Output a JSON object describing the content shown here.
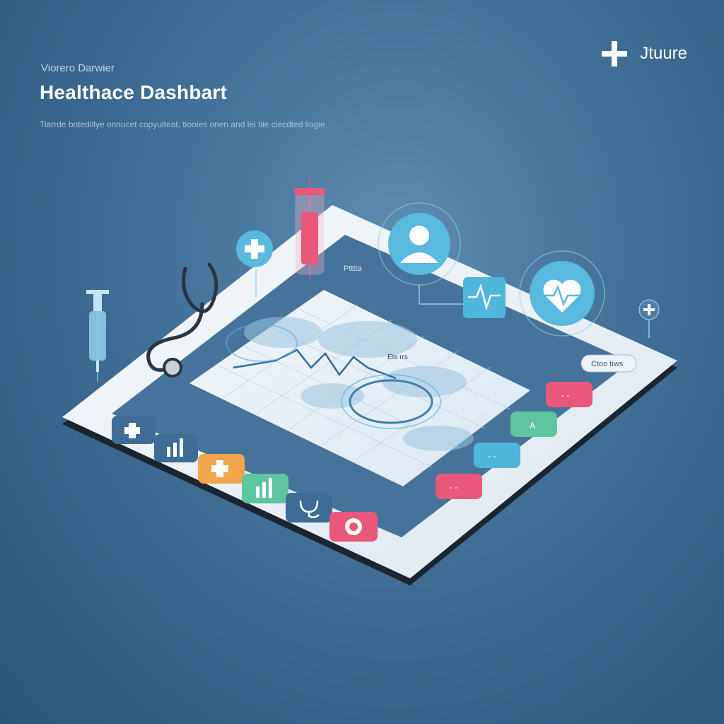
{
  "header": {
    "eyebrow": "Viorero Darwier",
    "title": "Healthace Dashbart",
    "subtitle": "Tiarrde bntedillye onnucet copyulteat, tiooies onen and lei tiie ciecdted liogie."
  },
  "brand": {
    "name": "Jtuure",
    "icon": "plus-icon"
  },
  "device": {
    "map_label": "Ets rrs",
    "header_label": "Ptttta",
    "pill_label": "Ctoo tiws",
    "tiles_left": [
      {
        "icon": "plus-icon",
        "color": "#3d6d96"
      },
      {
        "icon": "bar-chart-icon",
        "color": "#3d6d96"
      },
      {
        "icon": "plus-icon",
        "color": "#f2a54a"
      },
      {
        "icon": "bar-chart-icon",
        "color": "#5ec5a0"
      },
      {
        "icon": "stethoscope-icon",
        "color": "#3d6d96"
      },
      {
        "icon": "heart-icon",
        "color": "#e9577a"
      }
    ],
    "tiles_right": [
      {
        "label": "",
        "color": "#e9577a"
      },
      {
        "label": "A",
        "color": "#5ec5a0"
      },
      {
        "label": "",
        "color": "#4fb6dc"
      },
      {
        "label": "",
        "color": "#e9577a"
      }
    ]
  },
  "floating_icons": [
    "syringe-icon",
    "stethoscope-icon",
    "test-tube-icon",
    "plus-icon",
    "user-icon",
    "ecg-icon",
    "heart-icon",
    "plus-icon"
  ],
  "colors": {
    "background": "#3f6e96",
    "device_frame": "#eef3f8",
    "screen": "#45739b",
    "accent": "#4fb6dc"
  }
}
